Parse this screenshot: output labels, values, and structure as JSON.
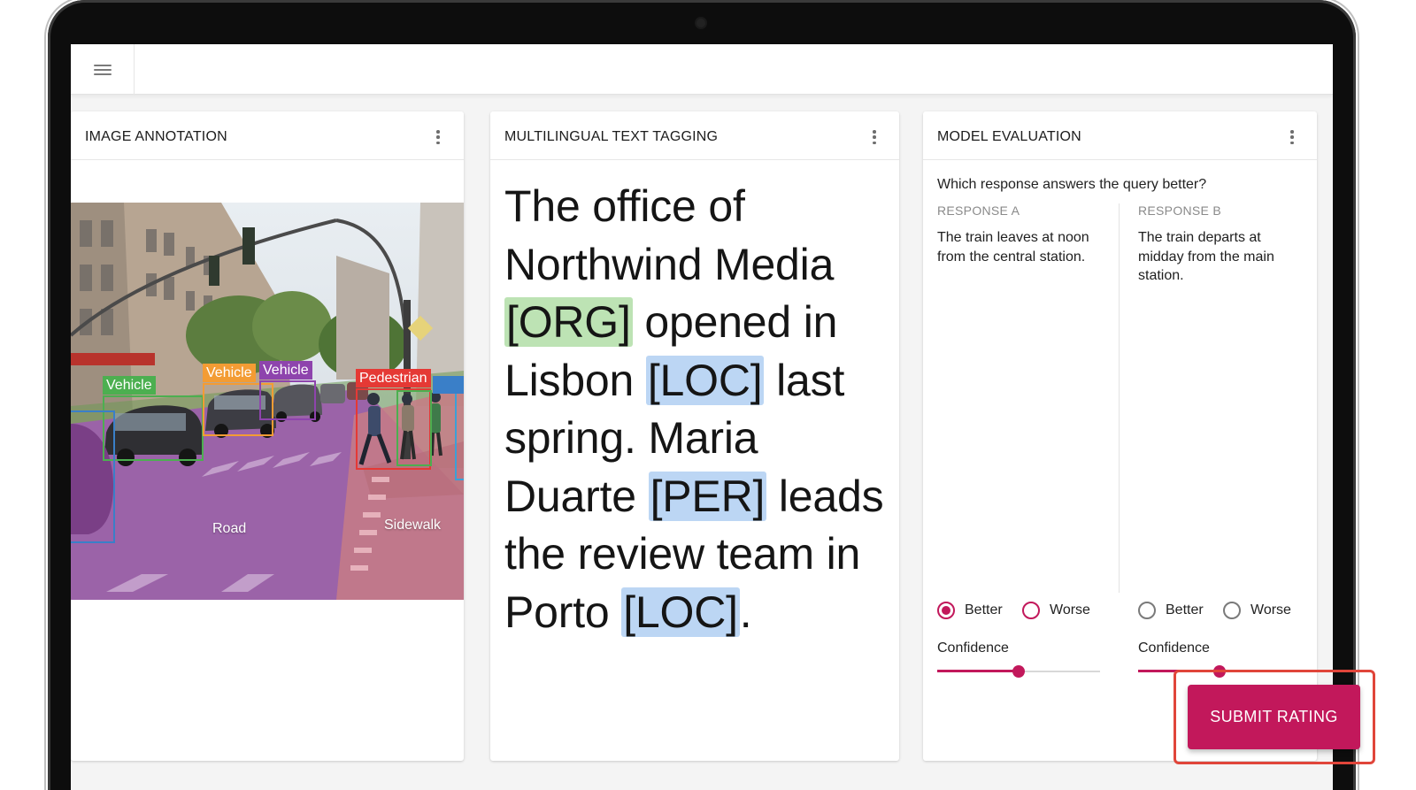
{
  "app": {
    "menu_icon": "hamburger-menu-icon"
  },
  "image_annotation": {
    "title": "IMAGE ANNOTATION",
    "boxes": [
      {
        "label": "Vehicle",
        "color": "#4caf50"
      },
      {
        "label": "Vehicle",
        "color": "#f39c34"
      },
      {
        "label": "Vehicle",
        "color": "#8e44ad"
      },
      {
        "label": "Pedestrian",
        "color": "#e53935"
      }
    ],
    "regions": {
      "road": "Road",
      "sidewalk": "Sidewalk"
    }
  },
  "text_tagging": {
    "title": "MULTILINGUAL TEXT TAGGING",
    "segments": [
      {
        "text": "The office of Northwind Media "
      },
      {
        "text": "[ORG]",
        "tag": "org"
      },
      {
        "text": " opened in Lisbon "
      },
      {
        "text": "[LOC]",
        "tag": "loc"
      },
      {
        "text": " last spring. Maria Duarte "
      },
      {
        "text": "[PER]",
        "tag": "per"
      },
      {
        "text": " leads the review team in Porto "
      },
      {
        "text": "[LOC]",
        "tag": "loc"
      },
      {
        "text": "."
      }
    ],
    "tag_colors": {
      "org": "#bde3b4",
      "loc": "#bcd6f4",
      "per": "#bcd6f4"
    }
  },
  "model_evaluation": {
    "title": "MODEL EVALUATION",
    "question": "Which response answers the query better?",
    "responses": [
      {
        "label": "RESPONSE A",
        "text": "The train leaves at noon from the central station.",
        "better_label": "Better",
        "worse_label": "Worse",
        "selected": "better",
        "confidence_label": "Confidence",
        "confidence": 0.5
      },
      {
        "label": "RESPONSE B",
        "text": "The train departs at midday from the main station.",
        "better_label": "Better",
        "worse_label": "Worse",
        "selected": null,
        "confidence_label": "Confidence",
        "confidence": 0.5
      }
    ],
    "accent_color": "#c2185b"
  },
  "actions": {
    "submit_label": "SUBMIT RATING"
  }
}
